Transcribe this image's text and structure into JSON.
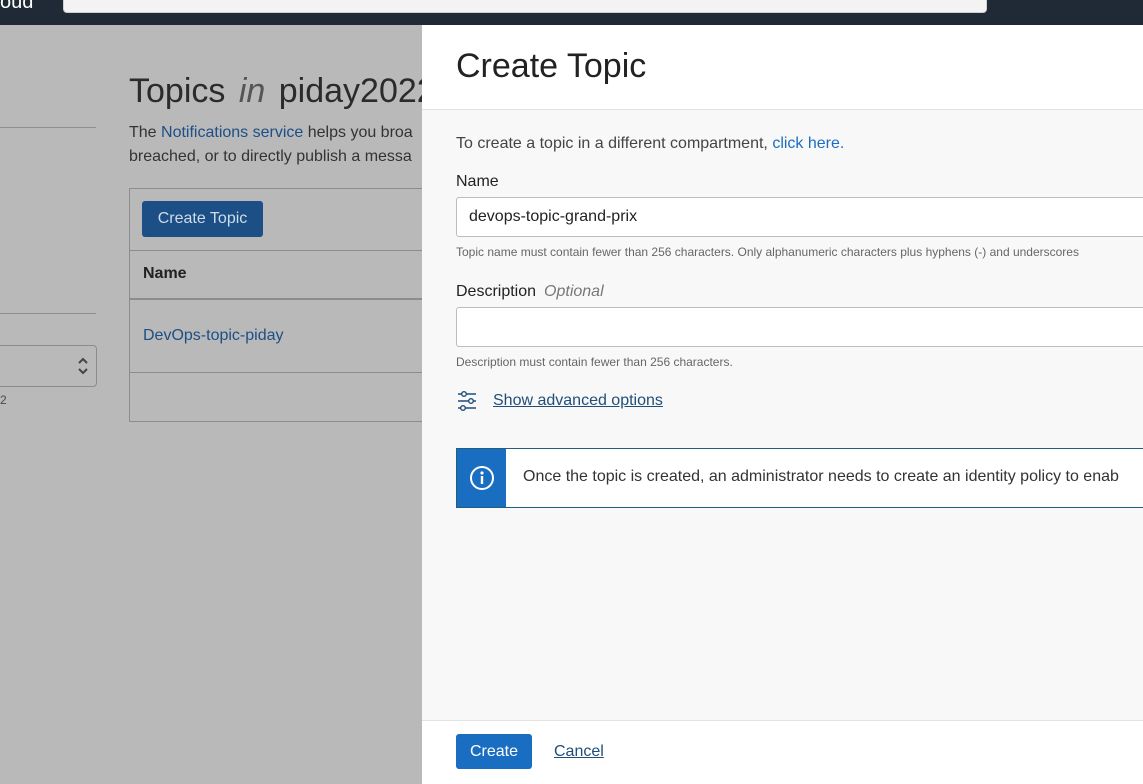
{
  "topbar": {
    "brand_fragment": "oud"
  },
  "background_page": {
    "title_prefix": "Topics",
    "title_in": "in",
    "title_compartment": "piday2022",
    "desc_line1_start": "The ",
    "desc_link": "Notifications service",
    "desc_line1_end": " helps you broa",
    "desc_line2": "breached, or to directly publish a messa",
    "create_button": "Create Topic",
    "table_header_name": "Name",
    "table_row_topic": "DevOps-topic-piday",
    "left_small_text": "2"
  },
  "panel": {
    "title": "Create Topic",
    "intro_text": "To create a topic in a different compartment, ",
    "intro_link": "click here.",
    "name": {
      "label": "Name",
      "value": "devops-topic-grand-prix",
      "help": "Topic name must contain fewer than 256 characters. Only alphanumeric characters plus hyphens (-) and underscores"
    },
    "description": {
      "label": "Description",
      "optional": "Optional",
      "value": "",
      "help": "Description must contain fewer than 256 characters."
    },
    "advanced_options": "Show advanced options",
    "info_message": "Once the topic is created, an administrator needs to create an identity policy to enab",
    "footer": {
      "create": "Create",
      "cancel": "Cancel"
    }
  },
  "colors": {
    "accent": "#1a6ec2",
    "link_dark": "#1f4e79",
    "overlay_bg": "#b9b9b9",
    "topbar": "#1f2a36"
  }
}
